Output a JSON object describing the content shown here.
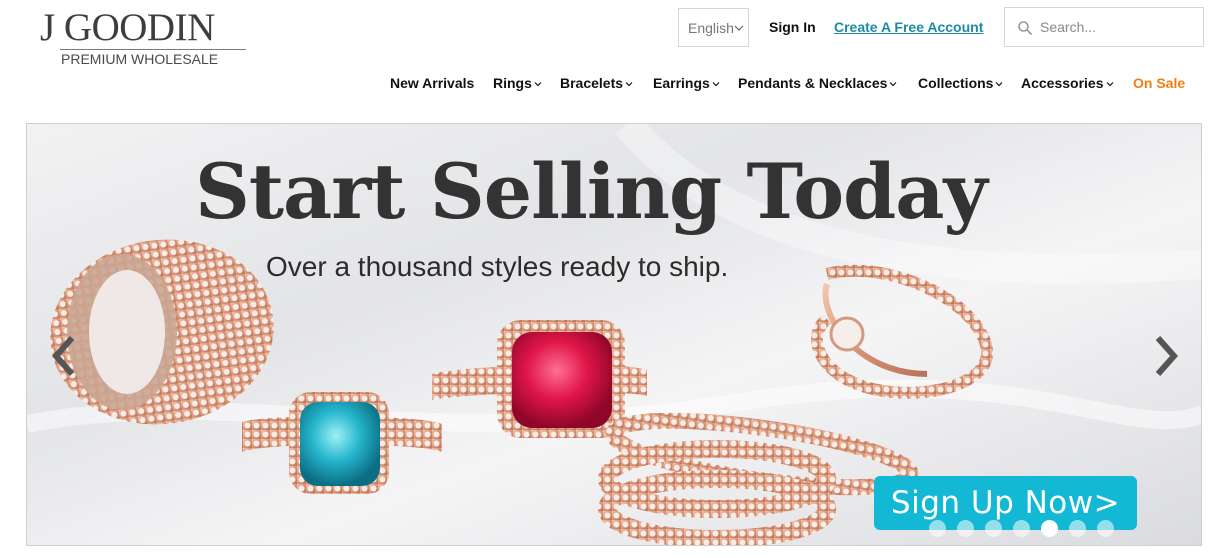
{
  "logo": {
    "name": "J GOODIN",
    "tagline": "PREMIUM WHOLESALE"
  },
  "language": {
    "selected": "English"
  },
  "auth": {
    "sign_in": "Sign In",
    "create_account": "Create A Free Account"
  },
  "search": {
    "placeholder": "Search...",
    "icon": "search-icon"
  },
  "nav": {
    "items": [
      {
        "label": "New Arrivals",
        "has_dropdown": false
      },
      {
        "label": "Rings",
        "has_dropdown": true
      },
      {
        "label": "Bracelets",
        "has_dropdown": true
      },
      {
        "label": "Earrings",
        "has_dropdown": true
      },
      {
        "label": "Pendants & Necklaces",
        "has_dropdown": true
      },
      {
        "label": "Collections",
        "has_dropdown": true
      },
      {
        "label": "Accessories",
        "has_dropdown": true
      },
      {
        "label": "On Sale",
        "has_dropdown": false
      }
    ]
  },
  "hero": {
    "title": "Start Selling Today",
    "subtitle": "Over a thousand styles ready to ship.",
    "cta": "Sign Up Now>",
    "prev_icon": "chevron-left-icon",
    "next_icon": "chevron-right-icon",
    "slides_count": 7,
    "active_slide": 5
  },
  "colors": {
    "accent_link": "#1f8aa3",
    "sale": "#f07d12",
    "cta_bg": "#13b8d4"
  }
}
